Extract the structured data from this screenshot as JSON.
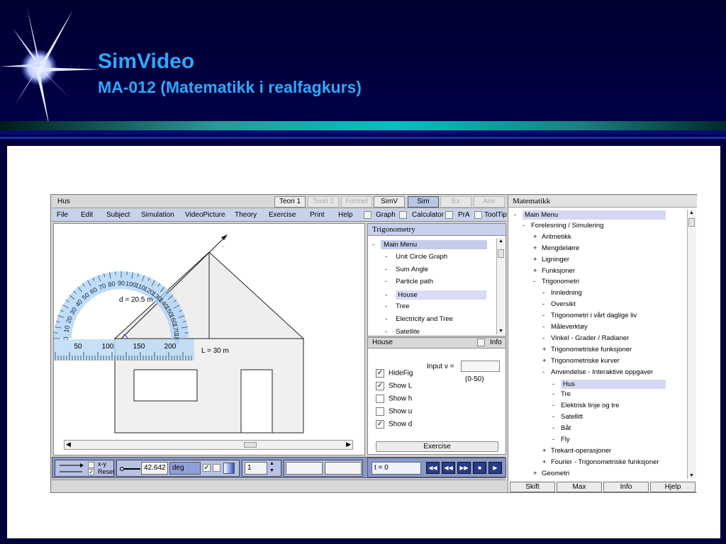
{
  "slide": {
    "title": "SimVideo",
    "subtitle": "MA-012 (Matematikk i realfagkurs)"
  },
  "app": {
    "title": "Hus",
    "tabs": [
      {
        "label": "Teori 1",
        "state": "normal"
      },
      {
        "label": "Teori 2",
        "state": "disabled"
      },
      {
        "label": "Formel",
        "state": "disabled"
      },
      {
        "label": "SimV",
        "state": "normal"
      },
      {
        "label": "Sim",
        "state": "active"
      },
      {
        "label": "Ex",
        "state": "disabled"
      },
      {
        "label": "Anv",
        "state": "disabled"
      }
    ],
    "menu": [
      "File",
      "Edit",
      "Subject",
      "Simulation",
      "VideoPicture",
      "Theory",
      "Exercise",
      "Print",
      "Help"
    ],
    "toggles": [
      "Graph",
      "Calculator",
      "PrA",
      "ToolTip"
    ]
  },
  "drawing": {
    "distance_label": "d = 20.5 m",
    "length_label": "L = 30 m",
    "ruler_labels": [
      "50",
      "100",
      "150",
      "200"
    ],
    "protractor_labels": [
      "0",
      "10",
      "20",
      "30",
      "40",
      "50",
      "60",
      "70",
      "80",
      "90",
      "100",
      "110",
      "120",
      "130",
      "140",
      "150",
      "160",
      "170",
      "180"
    ]
  },
  "controls": {
    "xy_label": "x-y",
    "reset_label": "Reset",
    "angle_value": "42.642",
    "angle_unit": "deg",
    "step_value": "1",
    "time_label": "t = 0"
  },
  "trigonometry": {
    "header": "Trigonometry",
    "root": "Main Menu",
    "items": [
      "Unit Circle Graph",
      "Sum Angle",
      "Particle path",
      "House",
      "Tree",
      "Electricity and Tree",
      "Satellite"
    ],
    "selected": "House"
  },
  "house_panel": {
    "title": "House",
    "info_label": "Info",
    "input_label": "Input v =",
    "input_value": "",
    "range_label": "(0-50)",
    "checks": [
      {
        "label": "HideFig",
        "checked": true
      },
      {
        "label": "Show L",
        "checked": true
      },
      {
        "label": "Show h",
        "checked": false
      },
      {
        "label": "Show u",
        "checked": false
      },
      {
        "label": "Show d",
        "checked": true
      }
    ],
    "exercise_label": "Exercise"
  },
  "matematikk": {
    "header": "Matematikk",
    "tree": [
      {
        "sign": "-",
        "label": "Main Menu",
        "level": 0,
        "selected": true
      },
      {
        "sign": "-",
        "label": "Forelesning / Simulering",
        "level": 1
      },
      {
        "sign": "+",
        "label": "Aritmetikk",
        "level": 2
      },
      {
        "sign": "+",
        "label": "Mengdelære",
        "level": 2
      },
      {
        "sign": "+",
        "label": "Ligninger",
        "level": 2
      },
      {
        "sign": "+",
        "label": "Funksjoner",
        "level": 2
      },
      {
        "sign": "-",
        "label": "Trigonometri",
        "level": 2
      },
      {
        "sign": "-",
        "label": "Innledning",
        "level": 3
      },
      {
        "sign": "-",
        "label": "Oversikt",
        "level": 3
      },
      {
        "sign": "-",
        "label": "Trigonometri i vårt daglige liv",
        "level": 3
      },
      {
        "sign": "-",
        "label": "Måleverktøy",
        "level": 3
      },
      {
        "sign": "-",
        "label": "Vinkel - Grader / Radianer",
        "level": 3
      },
      {
        "sign": "+",
        "label": "Trigonometriske funksjoner",
        "level": 3
      },
      {
        "sign": "+",
        "label": "Trigonometriske kurver",
        "level": 3
      },
      {
        "sign": "-",
        "label": "Anvendelse - Interaktive oppgaver",
        "level": 3
      },
      {
        "sign": "-",
        "label": "Hus",
        "level": 4,
        "selected": true
      },
      {
        "sign": "-",
        "label": "Tre",
        "level": 4
      },
      {
        "sign": "-",
        "label": "Elektrisk linje og tre",
        "level": 4
      },
      {
        "sign": "-",
        "label": "Satellitt",
        "level": 4
      },
      {
        "sign": "-",
        "label": "Båt",
        "level": 4
      },
      {
        "sign": "-",
        "label": "Fly",
        "level": 4
      },
      {
        "sign": "+",
        "label": "Trekant-operasjoner",
        "level": 3
      },
      {
        "sign": "+",
        "label": "Fourier - Trigonometriske funksjoner",
        "level": 3
      },
      {
        "sign": "+",
        "label": "Geometri",
        "level": 2
      }
    ],
    "buttons": [
      "Skift",
      "Max",
      "Info",
      "Hjelp"
    ]
  }
}
